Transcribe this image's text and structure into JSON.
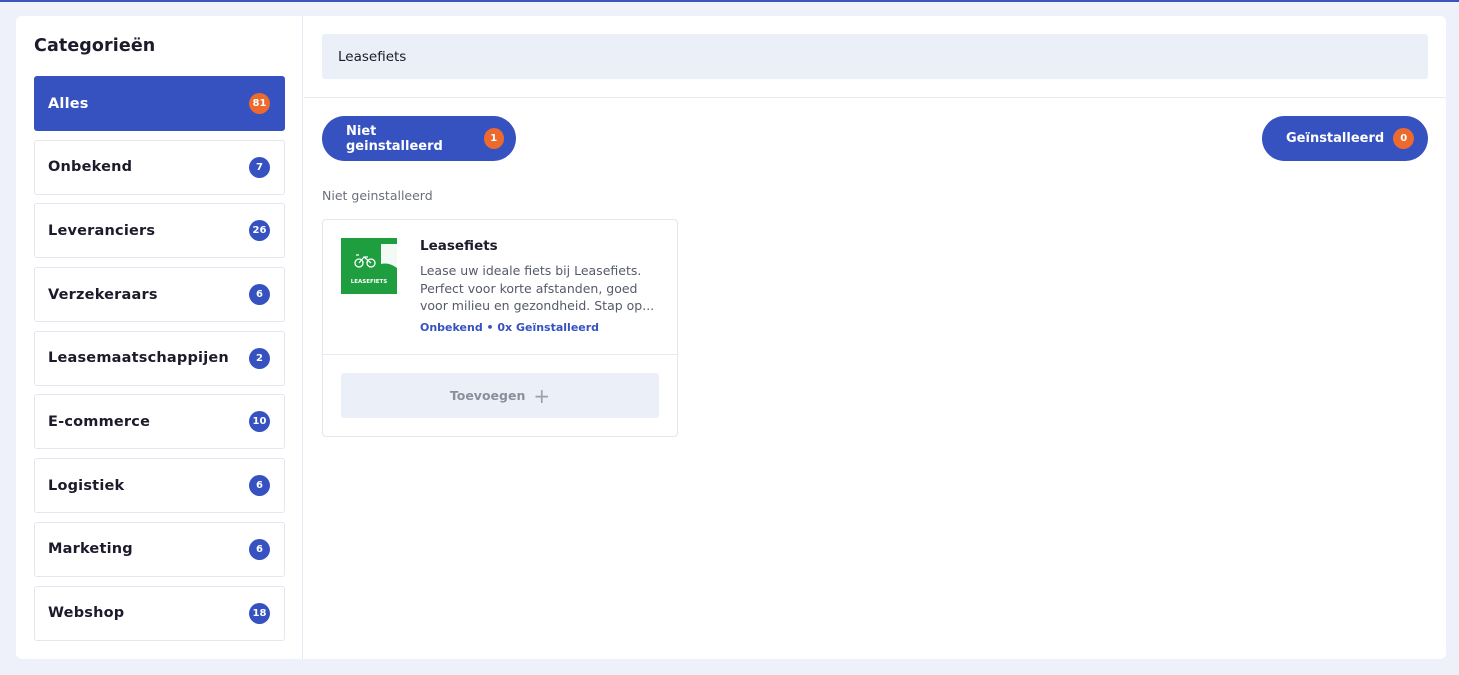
{
  "sidebar": {
    "title": "Categorieën",
    "items": [
      {
        "label": "Alles",
        "count": "81"
      },
      {
        "label": "Onbekend",
        "count": "7"
      },
      {
        "label": "Leveranciers",
        "count": "26"
      },
      {
        "label": "Verzekeraars",
        "count": "6"
      },
      {
        "label": "Leasemaatschappijen",
        "count": "2"
      },
      {
        "label": "E-commerce",
        "count": "10"
      },
      {
        "label": "Logistiek",
        "count": "6"
      },
      {
        "label": "Marketing",
        "count": "6"
      },
      {
        "label": "Webshop",
        "count": "18"
      }
    ]
  },
  "search": {
    "value": "Leasefiets"
  },
  "filters": {
    "not_installed": {
      "label": "Niet geinstalleerd",
      "count": "1"
    },
    "installed": {
      "label": "Geïnstalleerd",
      "count": "0"
    }
  },
  "section_label": "Niet geinstalleerd",
  "card": {
    "logo_text": "LEASEFIETS",
    "title": "Leasefiets",
    "desc_lines": [
      "Lease uw ideale fiets bij Leasefiets.",
      "Perfect voor korte afstanden, goed",
      "voor milieu en gezondheid. Stap op..."
    ],
    "meta": "Onbekend • 0x Geïnstalleerd",
    "add_label": "Toevoegen"
  },
  "colors": {
    "accent": "#3651c0",
    "badge_orange": "#ec6a2e",
    "logo_green": "#1f9e3f"
  }
}
